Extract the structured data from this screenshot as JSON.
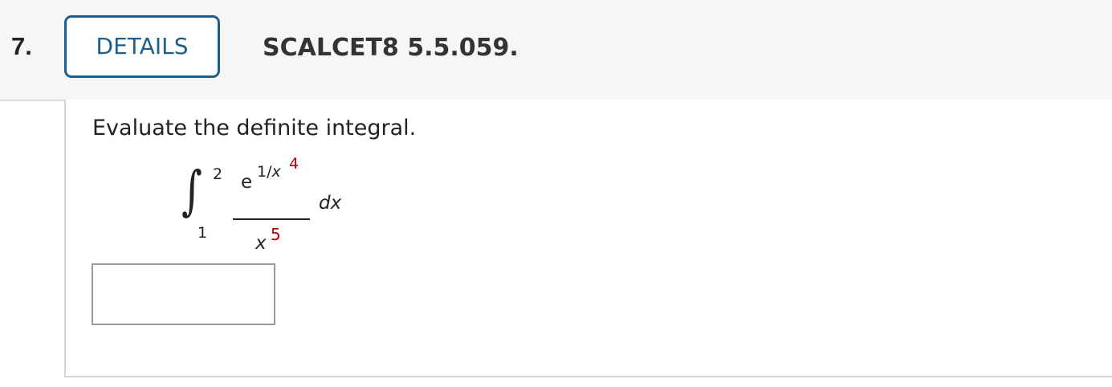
{
  "header": {
    "question_number": "7.",
    "details_label": "DETAILS",
    "problem_id": "SCALCET8 5.5.059."
  },
  "question": {
    "prompt": "Evaluate the definite integral.",
    "integral": {
      "upper_limit": "2",
      "lower_limit": "1",
      "numerator_base": "e",
      "numerator_exponent_prefix": "1/",
      "numerator_exponent_var": "x",
      "numerator_exponent_power": "4",
      "denominator_base": "x",
      "denominator_power": "5",
      "differential": "dx"
    },
    "answer": {
      "value": "",
      "placeholder": ""
    }
  },
  "colors": {
    "accent": "#1c5e8e",
    "highlight_red": "#c00000",
    "header_bg": "#f6f6f6"
  }
}
